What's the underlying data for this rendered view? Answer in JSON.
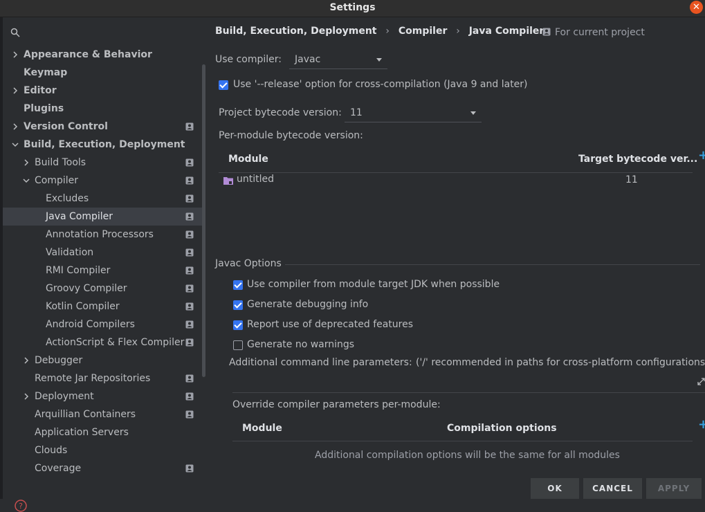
{
  "window": {
    "title": "Settings"
  },
  "search": {
    "placeholder": ""
  },
  "sidebar": {
    "items": [
      {
        "label": "Appearance & Behavior",
        "chevron": "right",
        "bold": true,
        "indent": 0,
        "project": false
      },
      {
        "label": "Keymap",
        "chevron": "",
        "bold": true,
        "indent": 0,
        "project": false
      },
      {
        "label": "Editor",
        "chevron": "right",
        "bold": true,
        "indent": 0,
        "project": false
      },
      {
        "label": "Plugins",
        "chevron": "",
        "bold": true,
        "indent": 0,
        "project": false
      },
      {
        "label": "Version Control",
        "chevron": "right",
        "bold": true,
        "indent": 0,
        "project": true
      },
      {
        "label": "Build, Execution, Deployment",
        "chevron": "down",
        "bold": true,
        "indent": 0,
        "project": false
      },
      {
        "label": "Build Tools",
        "chevron": "right",
        "bold": false,
        "indent": 1,
        "project": true
      },
      {
        "label": "Compiler",
        "chevron": "down",
        "bold": false,
        "indent": 1,
        "project": true
      },
      {
        "label": "Excludes",
        "chevron": "",
        "bold": false,
        "indent": 2,
        "project": true
      },
      {
        "label": "Java Compiler",
        "chevron": "",
        "bold": false,
        "indent": 2,
        "project": true,
        "selected": true
      },
      {
        "label": "Annotation Processors",
        "chevron": "",
        "bold": false,
        "indent": 2,
        "project": true
      },
      {
        "label": "Validation",
        "chevron": "",
        "bold": false,
        "indent": 2,
        "project": true
      },
      {
        "label": "RMI Compiler",
        "chevron": "",
        "bold": false,
        "indent": 2,
        "project": true
      },
      {
        "label": "Groovy Compiler",
        "chevron": "",
        "bold": false,
        "indent": 2,
        "project": true
      },
      {
        "label": "Kotlin Compiler",
        "chevron": "",
        "bold": false,
        "indent": 2,
        "project": true
      },
      {
        "label": "Android Compilers",
        "chevron": "",
        "bold": false,
        "indent": 2,
        "project": true
      },
      {
        "label": "ActionScript & Flex Compiler",
        "chevron": "",
        "bold": false,
        "indent": 2,
        "project": true
      },
      {
        "label": "Debugger",
        "chevron": "right",
        "bold": false,
        "indent": 1,
        "project": false
      },
      {
        "label": "Remote Jar Repositories",
        "chevron": "",
        "bold": false,
        "indent": 1,
        "project": true
      },
      {
        "label": "Deployment",
        "chevron": "right",
        "bold": false,
        "indent": 1,
        "project": true
      },
      {
        "label": "Arquillian Containers",
        "chevron": "",
        "bold": false,
        "indent": 1,
        "project": true
      },
      {
        "label": "Application Servers",
        "chevron": "",
        "bold": false,
        "indent": 1,
        "project": false
      },
      {
        "label": "Clouds",
        "chevron": "",
        "bold": false,
        "indent": 1,
        "project": false
      },
      {
        "label": "Coverage",
        "chevron": "",
        "bold": false,
        "indent": 1,
        "project": true
      }
    ]
  },
  "breadcrumb": {
    "items": [
      "Build, Execution, Deployment",
      "Compiler",
      "Java Compiler"
    ],
    "separator": "›"
  },
  "scope": {
    "label": "For current project"
  },
  "compiler": {
    "use_compiler_label": "Use compiler:",
    "use_compiler_value": "Javac",
    "release_option_label": "Use '--release' option for cross-compilation (Java 9 and later)",
    "release_option_checked": true,
    "project_bytecode_label": "Project bytecode version:",
    "project_bytecode_value": "11",
    "per_module_label": "Per-module bytecode version:"
  },
  "module_table": {
    "headers": [
      "Module",
      "Target bytecode ver..."
    ],
    "rows": [
      {
        "module": "untitled",
        "target": "11"
      }
    ]
  },
  "javac": {
    "section_label": "Javac Options",
    "options": [
      {
        "label": "Use compiler from module target JDK when possible",
        "checked": true
      },
      {
        "label": "Generate debugging info",
        "checked": true
      },
      {
        "label": "Report use of deprecated features",
        "checked": true
      },
      {
        "label": "Generate no warnings",
        "checked": false
      }
    ],
    "additional_params_label": "Additional command line parameters:",
    "additional_params_hint": "('/' recommended in paths for cross-platform configurations)"
  },
  "override": {
    "label": "Override compiler parameters per-module:",
    "headers": [
      "Module",
      "Compilation options"
    ],
    "empty_text": "Additional compilation options will be the same for all modules"
  },
  "buttons": {
    "ok": "OK",
    "cancel": "CANCEL",
    "apply": "APPLY"
  },
  "colors": {
    "background": "#2b2d30",
    "accent": "#3574f0",
    "close": "#e95420",
    "add": "#35a0e0"
  },
  "icons": {
    "search": "search-icon",
    "close": "close-icon",
    "project_scope": "project-scope-icon",
    "folder": "module-folder-icon",
    "add": "add-icon",
    "expand": "expand-icon",
    "help": "help-icon"
  }
}
